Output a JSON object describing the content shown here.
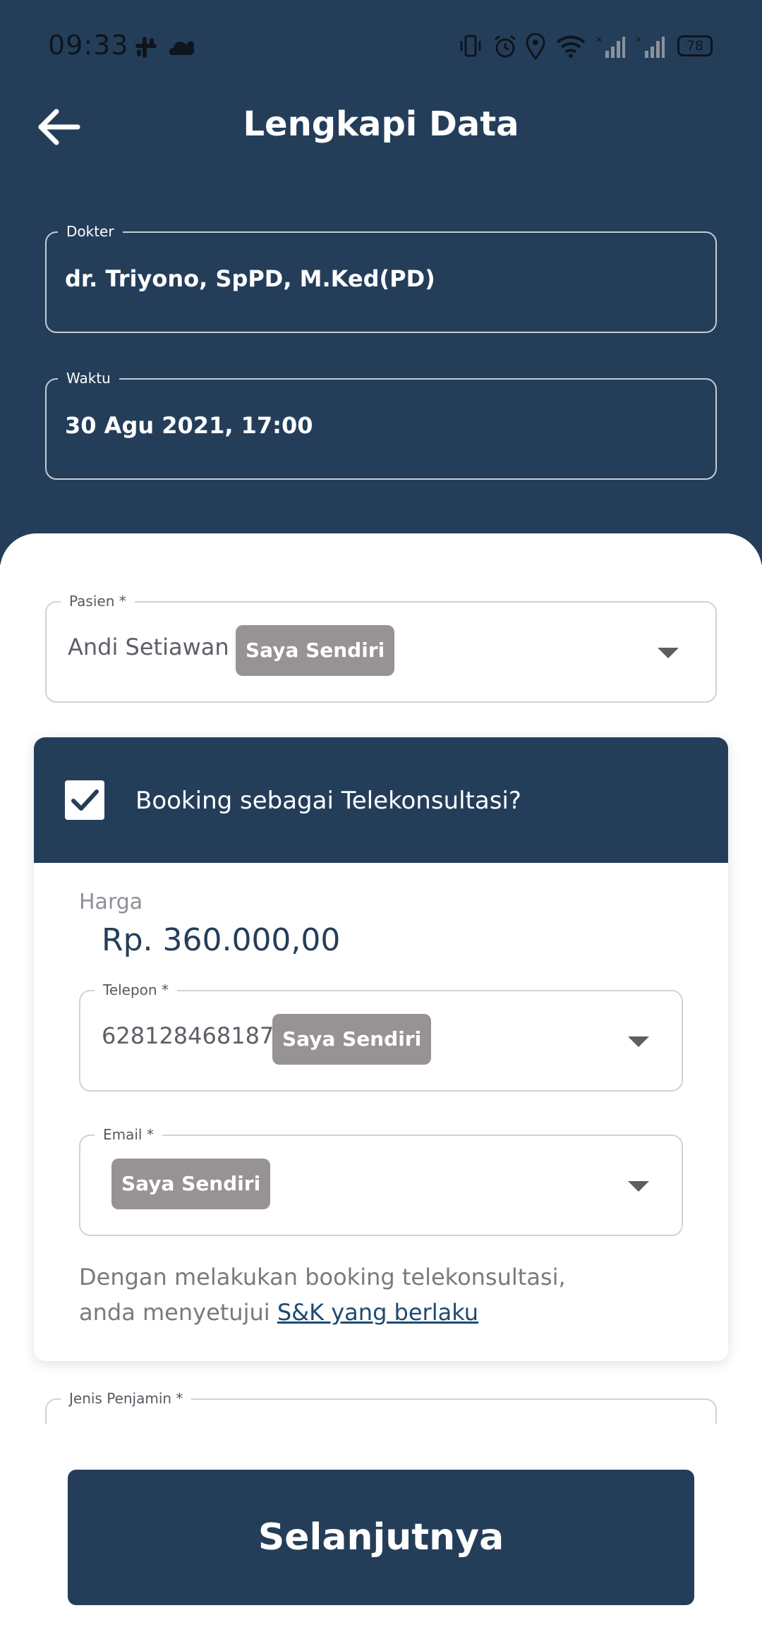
{
  "status_bar": {
    "time": "09:33",
    "battery": "78",
    "icons": [
      "slack-icon",
      "cloud-icon",
      "vibrate-icon",
      "alarm-icon",
      "location-icon",
      "wifi-icon",
      "signal-icon",
      "signal-icon"
    ]
  },
  "header": {
    "title": "Lengkapi Data",
    "back_icon": "arrow-left-icon"
  },
  "doctor": {
    "label": "Dokter",
    "value": "dr. Triyono, SpPD, M.Ked(PD)"
  },
  "schedule": {
    "label": "Waktu",
    "value": "30 Agu 2021, 17:00"
  },
  "patient": {
    "label": "Pasien *",
    "value": "Andi Setiawan",
    "chip": "Saya Sendiri"
  },
  "telekonsultasi": {
    "checked": true,
    "label": "Booking sebagai Telekonsultasi?",
    "price_label": "Harga",
    "price_value": "Rp. 360.000,00",
    "phone": {
      "label": "Telepon *",
      "value": "6281284681878",
      "chip": "Saya Sendiri"
    },
    "email": {
      "label": "Email *",
      "value": "",
      "chip": "Saya Sendiri"
    },
    "terms_text_1": "Dengan melakukan booking telekonsultasi,",
    "terms_text_2": "anda menyetujui",
    "terms_link": "S&K yang berlaku"
  },
  "guarantor": {
    "label": "Jenis Penjamin *"
  },
  "submit_label": "Selanjutnya",
  "colors": {
    "primary": "#243e5a",
    "chip": "#969295",
    "link": "#1f4a70"
  }
}
